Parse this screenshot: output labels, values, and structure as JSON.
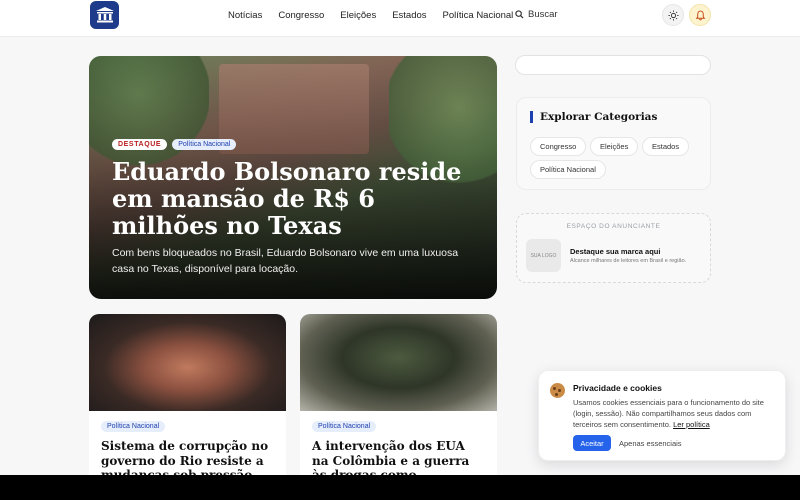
{
  "nav": {
    "items": [
      "Notícias",
      "Congresso",
      "Eleições",
      "Estados",
      "Política Nacional"
    ],
    "search_label": "Buscar"
  },
  "hero": {
    "badge_primary": "DESTAQUE",
    "badge_category": "Política Nacional",
    "title": "Eduardo Bolsonaro reside em mansão de R$ 6 milhões no Texas",
    "subtitle": "Com bens bloqueados no Brasil, Eduardo Bolsonaro vive em uma luxuosa casa no Texas, disponível para locação."
  },
  "cards": [
    {
      "category": "Política Nacional",
      "title": "Sistema de corrupção no governo do Rio resiste a mudanças sob pressão política"
    },
    {
      "category": "Política Nacional",
      "title": "A intervenção dos EUA na Colômbia e a guerra às drogas como obstáculo à paz"
    }
  ],
  "categories": {
    "title": "Explorar Categorias",
    "chips": [
      "Congresso",
      "Eleições",
      "Estados",
      "Política Nacional"
    ]
  },
  "ad": {
    "label": "ESPAÇO DO ANUNCIANTE",
    "logo_text": "SUA LOGO",
    "title": "Destaque sua marca aqui",
    "subtitle": "Alcance milhares de leitores em Brasil e região."
  },
  "cookie": {
    "title": "Privacidade e cookies",
    "text": "Usamos cookies essenciais para o funcionamento do site (login, sessão). Não compartilhamos seus dados com terceiros sem consentimento.",
    "link": "Ler política",
    "accept": "Aceitar",
    "essential": "Apenas essenciais"
  },
  "colors": {
    "brand": "#1e3a8a",
    "accent": "#2563eb",
    "badge_red": "#b91c1c"
  }
}
